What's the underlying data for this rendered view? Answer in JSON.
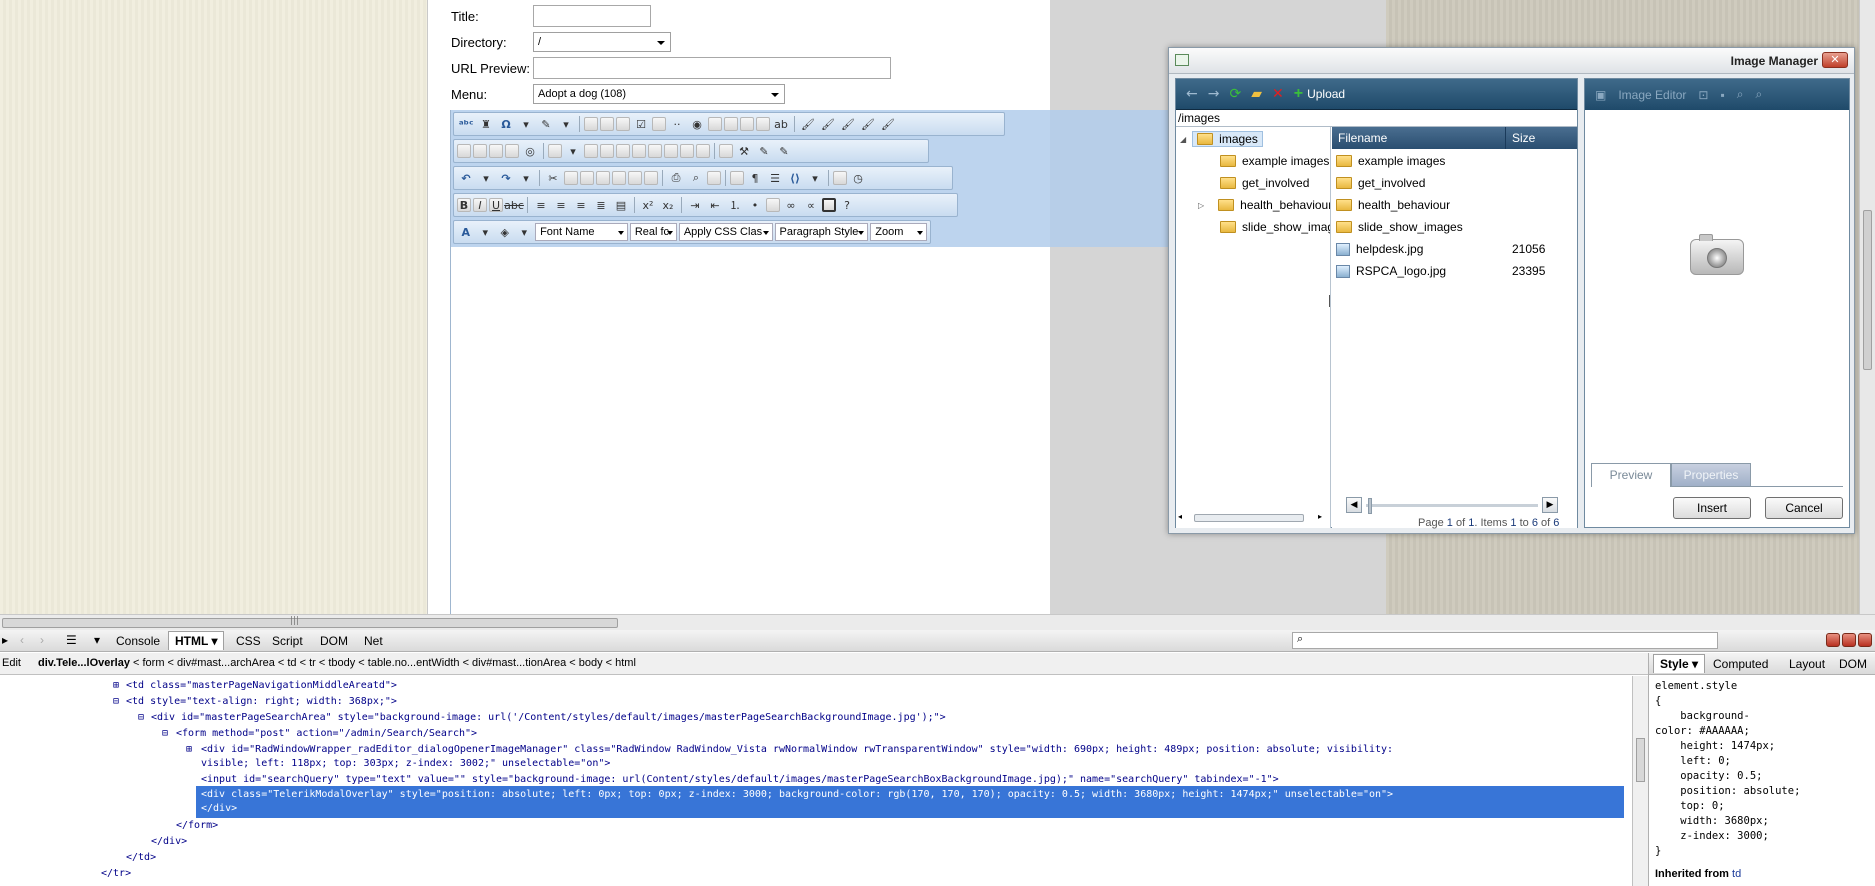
{
  "form": {
    "title_label": "Title:",
    "directory_label": "Directory:",
    "directory_value": "/",
    "url_preview_label": "URL Preview:",
    "menu_label": "Menu:",
    "menu_value": "Adopt a dog (108)"
  },
  "editor_toolbar": {
    "font_name": "Font Name",
    "font_size": "Real fc",
    "css_class": "Apply CSS Clas",
    "paragraph_style": "Paragraph Style",
    "zoom": "Zoom"
  },
  "image_manager": {
    "title": "Image Manager",
    "upload_label": "Upload",
    "path": "/images",
    "image_editor_label": "Image Editor",
    "tree": [
      "images",
      "example images",
      "get_involved",
      "health_behaviour",
      "slide_show_images"
    ],
    "columns": {
      "filename": "Filename",
      "size": "Size"
    },
    "files": [
      {
        "name": "example images",
        "size": "",
        "kind": "folder"
      },
      {
        "name": "get_involved",
        "size": "",
        "kind": "folder"
      },
      {
        "name": "health_behaviour",
        "size": "",
        "kind": "folder"
      },
      {
        "name": "slide_show_images",
        "size": "",
        "kind": "folder"
      },
      {
        "name": "helpdesk.jpg",
        "size": "21056",
        "kind": "image"
      },
      {
        "name": "RSPCA_logo.jpg",
        "size": "23395",
        "kind": "image"
      }
    ],
    "pager": {
      "page_word": "Page",
      "page": "1",
      "of_word": "of",
      "pages": "1",
      "items_word": "Items",
      "from": "1",
      "to_word": "to",
      "to": "6",
      "total": "6"
    },
    "tabs": {
      "preview": "Preview",
      "properties": "Properties"
    },
    "insert_label": "Insert",
    "cancel_label": "Cancel"
  },
  "firebug": {
    "tabs": [
      "Console",
      "HTML",
      "CSS",
      "Script",
      "DOM",
      "Net"
    ],
    "active_tab": "HTML",
    "edit_label": "Edit",
    "breadcrumb_active": "div.Tele...lOverlay",
    "breadcrumb_rest": " < form < div#mast...archArea < td < tr < tbody < table.no...entWidth < div#mast...tionArea < body < html",
    "code_lines": [
      "<td class=\"masterPageNavigationMiddleAreatd\">",
      "<td style=\"text-align: right; width: 368px;\">",
      "<div id=\"masterPageSearchArea\" style=\"background-image: url('/Content/styles/default/images/masterPageSearchBackgroundImage.jpg');\">",
      "<form method=\"post\" action=\"/admin/Search/Search\">",
      "<div id=\"RadWindowWrapper_radEditor_dialogOpenerImageManager\" class=\"RadWindow RadWindow_Vista rwNormalWindow rwTransparentWindow\" style=\"width: 690px; height: 489px; position: absolute; visibility:",
      "visible; left: 118px; top: 303px; z-index: 3002;\" unselectable=\"on\">",
      "<input id=\"searchQuery\" type=\"text\" value=\"\" style=\"background-image: url(Content/styles/default/images/masterPageSearchBoxBackgroundImage.jpg);\" name=\"searchQuery\" tabindex=\"-1\">",
      "<div class=\"TelerikModalOverlay\" style=\"position: absolute; left: 0px; top: 0px; z-index: 3000; background-color: rgb(170, 170, 170); opacity: 0.5; width: 3680px; height: 1474px;\" unselectable=\"on\">",
      "</div>",
      "</form>",
      "</div>",
      "</td>",
      "</tr>"
    ],
    "side_tabs": [
      "Style",
      "Computed",
      "Layout",
      "DOM"
    ],
    "side_body": "element.style\n{\n    background-\ncolor: #AAAAAA;\n    height: 1474px;\n    left: 0;\n    opacity: 0.5;\n    position: absolute;\n    top: 0;\n    width: 3680px;\n    z-index: 3000;\n}",
    "inherited_label": "Inherited from",
    "inherited_tag": "td"
  }
}
